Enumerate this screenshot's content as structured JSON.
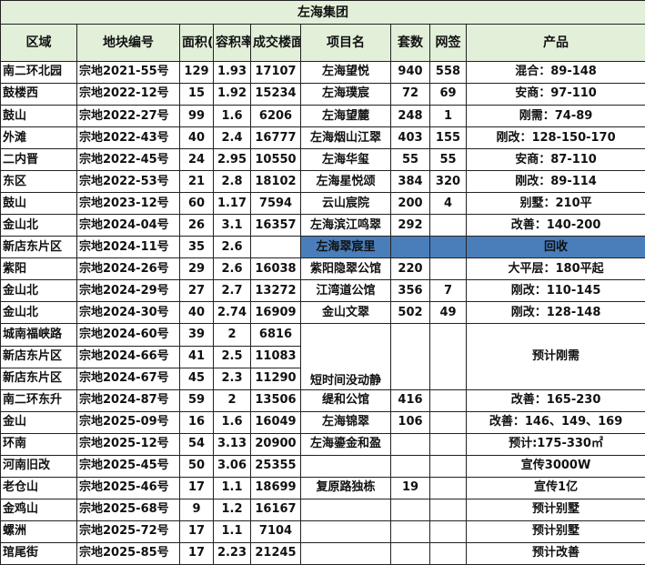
{
  "title": "左海集团",
  "headers": [
    "区域",
    "地块编号",
    "面积(亩)",
    "容积率",
    "成交楼面价",
    "项目名",
    "套数",
    "网签",
    "产品"
  ],
  "watermark": "",
  "colors": {
    "header_bg": "#e2efd9",
    "highlight": "#4a7ebb",
    "border": "#222222"
  },
  "rows": [
    {
      "area": "南二环北园",
      "code": "宗地2021-55号",
      "mu": "129",
      "far": "1.93",
      "price": "17107",
      "project": "左海望悦",
      "units": "940",
      "signed": "558",
      "product": "混合：89-148"
    },
    {
      "area": "鼓楼西",
      "code": "宗地2022-12号",
      "mu": "15",
      "far": "1.92",
      "price": "15234",
      "project": "左海璞宸",
      "units": "72",
      "signed": "69",
      "product": "安商：97-110"
    },
    {
      "area": "鼓山",
      "code": "宗地2022-27号",
      "mu": "99",
      "far": "1.6",
      "price": "6206",
      "project": "左海望麓",
      "units": "248",
      "signed": "1",
      "product": "刚需：74-89"
    },
    {
      "area": "外滩",
      "code": "宗地2022-43号",
      "mu": "40",
      "far": "2.4",
      "price": "16777",
      "project": "左海烟山江翠",
      "units": "403",
      "signed": "155",
      "product": "刚改：128-150-170"
    },
    {
      "area": "二内晋",
      "code": "宗地2022-45号",
      "mu": "24",
      "far": "2.95",
      "price": "10550",
      "project": "左海华玺",
      "units": "55",
      "signed": "55",
      "product": "安商：87-110"
    },
    {
      "area": "东区",
      "code": "宗地2022-53号",
      "mu": "21",
      "far": "2.8",
      "price": "18102",
      "project": "左海星悦颂",
      "units": "384",
      "signed": "320",
      "product": "刚改：89-114"
    },
    {
      "area": "鼓山",
      "code": "宗地2023-12号",
      "mu": "60",
      "far": "1.17",
      "price": "7594",
      "project": "云山宸院",
      "units": "200",
      "signed": "4",
      "product": "别墅：210平"
    },
    {
      "area": "金山北",
      "code": "宗地2024-04号",
      "mu": "26",
      "far": "3.1",
      "price": "16357",
      "project": "左海滨江鸣翠",
      "units": "292",
      "signed": "",
      "product": "改善：140-200"
    },
    {
      "area": "新店东片区",
      "code": "宗地2024-11号",
      "mu": "35",
      "far": "2.6",
      "price": "",
      "project": "左海翠宸里",
      "units": "",
      "signed": "",
      "product": "回收"
    },
    {
      "area": "紫阳",
      "code": "宗地2024-26号",
      "mu": "29",
      "far": "2.6",
      "price": "16038",
      "project": "紫阳隐翠公馆",
      "units": "220",
      "signed": "",
      "product": "大平层：180平起"
    },
    {
      "area": "金山北",
      "code": "宗地2024-29号",
      "mu": "27",
      "far": "2.7",
      "price": "13272",
      "project": "江湾道公馆",
      "units": "356",
      "signed": "7",
      "product": "刚改：110-145"
    },
    {
      "area": "金山北",
      "code": "宗地2024-30号",
      "mu": "40",
      "far": "2.74",
      "price": "16909",
      "project": "金山文翠",
      "units": "502",
      "signed": "49",
      "product": "刚改：128-148"
    },
    {
      "area": "城南福峡路",
      "code": "宗地2024-60号",
      "mu": "39",
      "far": "2",
      "price": "6816"
    },
    {
      "area": "新店东片区",
      "code": "宗地2024-66号",
      "mu": "41",
      "far": "2.5",
      "price": "11083"
    },
    {
      "area": "新店东片区",
      "code": "宗地2024-67号",
      "mu": "45",
      "far": "2.3",
      "price": "11290"
    },
    {
      "area": "南二环东升",
      "code": "宗地2024-87号",
      "mu": "59",
      "far": "2",
      "price": "13506",
      "project": "缇和公馆",
      "units": "416",
      "signed": "",
      "product": "改善：165-230"
    },
    {
      "area": "金山",
      "code": "宗地2025-09号",
      "mu": "16",
      "far": "1.6",
      "price": "16049",
      "project": "左海锦翠",
      "units": "106",
      "signed": "",
      "product": "改善：146、149、169"
    },
    {
      "area": "环南",
      "code": "宗地2025-12号",
      "mu": "54",
      "far": "3.13",
      "price": "20900",
      "project": "左海鎏金和盈",
      "units": "",
      "signed": "",
      "product": "预计:175-330㎡"
    },
    {
      "area": "河南旧改",
      "code": "宗地2025-45号",
      "mu": "50",
      "far": "3.06",
      "price": "25355",
      "product": "宣传3000W"
    },
    {
      "area": "老仓山",
      "code": "宗地2025-46号",
      "mu": "17",
      "far": "1.1",
      "price": "18699",
      "project": "复原路独栋",
      "units": "19",
      "signed": "",
      "product": "宣传1亿"
    },
    {
      "area": "金鸡山",
      "code": "宗地2025-68号",
      "mu": "9",
      "far": "1.2",
      "price": "16167",
      "product": "预计别墅"
    },
    {
      "area": "螺洲",
      "code": "宗地2025-72号",
      "mu": "17",
      "far": "1.1",
      "price": "7104",
      "product": "预计别墅"
    },
    {
      "area": "琯尾街",
      "code": "宗地2025-85号",
      "mu": "17",
      "far": "2.23",
      "price": "21245",
      "product": "预计改善"
    }
  ],
  "merged": {
    "project_quiet": "短时间没动静",
    "product_expected": "预计刚需"
  }
}
